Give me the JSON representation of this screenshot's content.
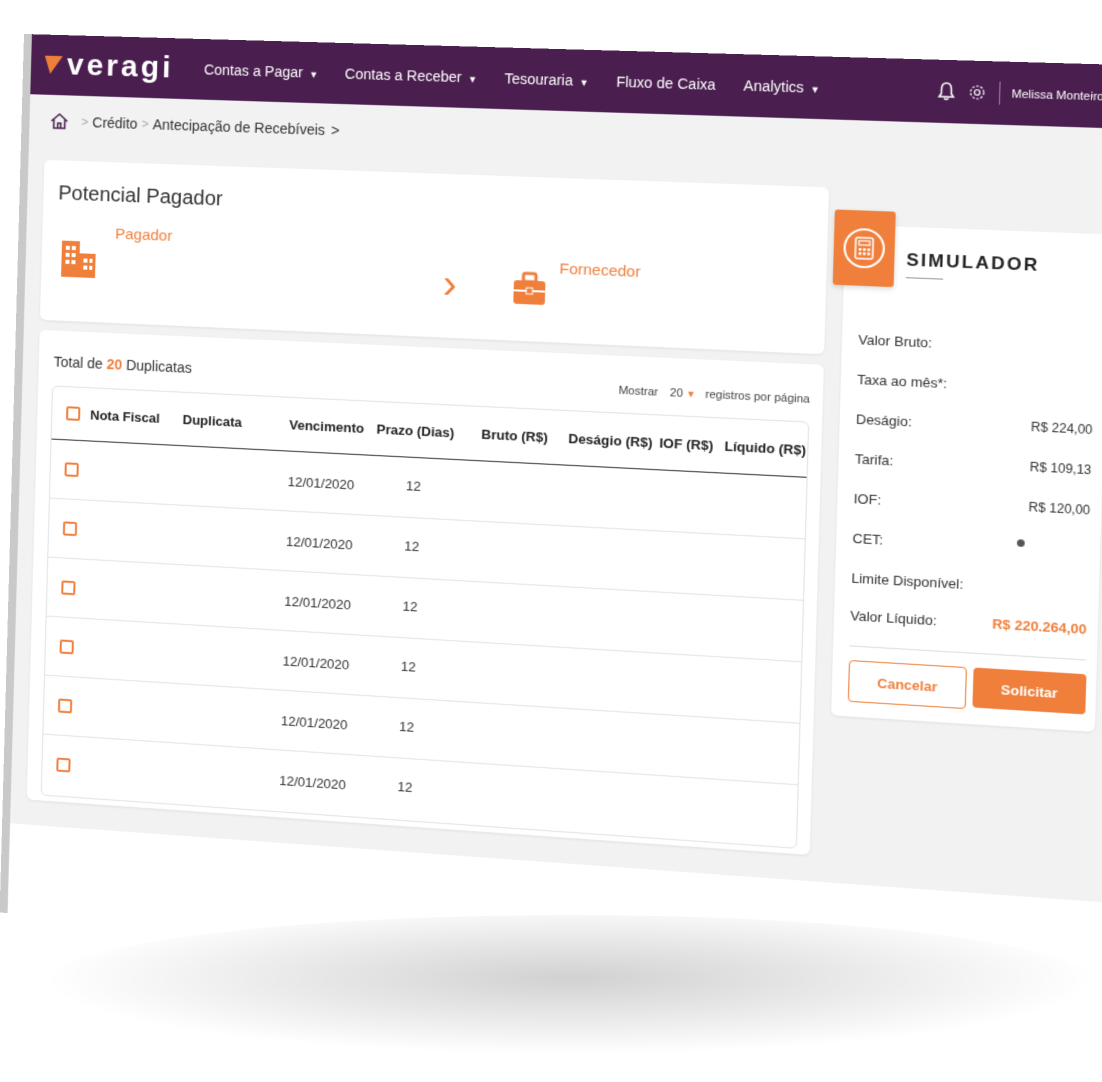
{
  "brand": {
    "name": "veragi",
    "accent": "#f07f3c",
    "nav_bg": "#4a1f4f"
  },
  "nav": {
    "items": [
      {
        "label": "Contas a Pagar",
        "dropdown": true
      },
      {
        "label": "Contas a Receber",
        "dropdown": true
      },
      {
        "label": "Tesouraria",
        "dropdown": true
      },
      {
        "label": "Fluxo de Caixa",
        "dropdown": false
      },
      {
        "label": "Analytics",
        "dropdown": true
      }
    ],
    "user": "Melissa Monteiro",
    "icons": [
      "bell-icon",
      "gear-icon"
    ]
  },
  "breadcrumb": {
    "items": [
      "Crédito",
      "Antecipação de Recebíveis"
    ]
  },
  "payer": {
    "title": "Potencial Pagador",
    "pagador_label": "Pagador",
    "fornecedor_label": "Fornecedor"
  },
  "table": {
    "total_prefix": "Total de",
    "total_count": "20",
    "total_suffix": "Duplicatas",
    "mostrar_label": "Mostrar",
    "page_size": "20",
    "per_page_label": "registros por página",
    "headers": [
      "Nota Fiscal",
      "Duplicata",
      "Vencimento",
      "Prazo (Dias)",
      "Bruto (R$)",
      "Deságio (R$)",
      "IOF (R$)",
      "Líquido (R$)"
    ],
    "rows": [
      {
        "vencimento": "12/01/2020",
        "prazo": "12"
      },
      {
        "vencimento": "12/01/2020",
        "prazo": "12"
      },
      {
        "vencimento": "12/01/2020",
        "prazo": "12"
      },
      {
        "vencimento": "12/01/2020",
        "prazo": "12"
      },
      {
        "vencimento": "12/01/2020",
        "prazo": "12"
      },
      {
        "vencimento": "12/01/2020",
        "prazo": "12"
      }
    ]
  },
  "simulador": {
    "title": "SIMULADOR",
    "rows": [
      {
        "label": "Valor Bruto:",
        "value": ""
      },
      {
        "label": "Taxa ao mês*:",
        "value": ""
      },
      {
        "label": "Deságio:",
        "value": "R$ 224,00"
      },
      {
        "label": "Tarifa:",
        "value": "R$ 109,13"
      },
      {
        "label": "IOF:",
        "value": "R$ 120,00"
      },
      {
        "label": "CET:",
        "value": ""
      },
      {
        "label": "Limite Disponível:",
        "value": ""
      }
    ],
    "net_label": "Valor Líquido:",
    "net_value": "R$ 220.264,00",
    "cancel_label": "Cancelar",
    "submit_label": "Solicitar"
  }
}
